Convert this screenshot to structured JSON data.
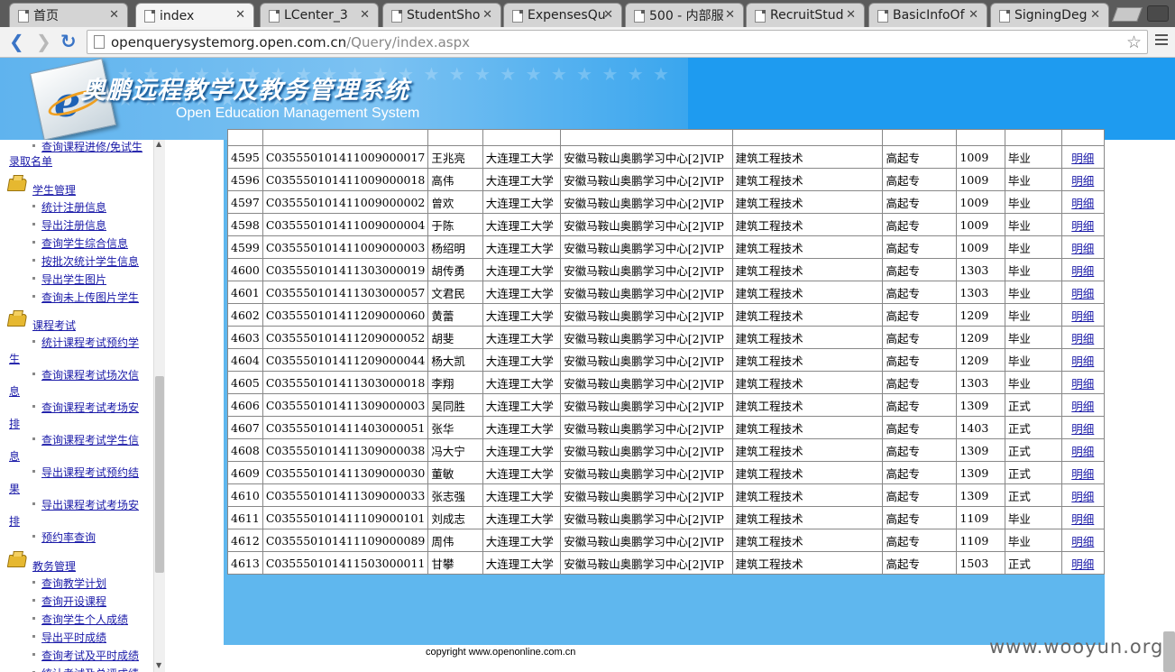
{
  "browser": {
    "tabs": [
      {
        "label": "首页",
        "active": false
      },
      {
        "label": "index",
        "active": true
      },
      {
        "label": "LCenter_3",
        "active": false
      },
      {
        "label": "StudentSho",
        "active": false
      },
      {
        "label": "ExpensesQu",
        "active": false
      },
      {
        "label": "500 - 内部服",
        "active": false
      },
      {
        "label": "RecruitStud",
        "active": false
      },
      {
        "label": "BasicInfoOf",
        "active": false
      },
      {
        "label": "SigningDeg",
        "active": false
      }
    ],
    "url_host": "openquerysystemorg.open.com.cn",
    "url_path": "/Query/index.aspx"
  },
  "header": {
    "title": "奥鹏远程教学及教务管理系统",
    "subtitle": "Open Education Management System"
  },
  "sidebar": {
    "top_links": [
      "查询课程进修/免试生",
      "录取名单"
    ],
    "groups": [
      {
        "title": "学生管理",
        "items": [
          "统计注册信息",
          "导出注册信息",
          "查询学生综合信息",
          "按批次统计学生信息",
          "导出学生图片",
          "查询未上传图片学生"
        ]
      },
      {
        "title": "课程考试",
        "items": [
          {
            "label": "统计课程考试预约学",
            "cont": "生"
          },
          {
            "label": "查询课程考试场次信",
            "cont": "息"
          },
          {
            "label": "查询课程考试考场安",
            "cont": "排"
          },
          {
            "label": "查询课程考试学生信",
            "cont": "息"
          },
          {
            "label": "导出课程考试预约结",
            "cont": "果"
          },
          {
            "label": "导出课程考试考场安",
            "cont": "排"
          },
          {
            "label": "预约率查询",
            "cont": ""
          }
        ]
      },
      {
        "title": "教务管理",
        "items": [
          "查询教学计划",
          "查询开设课程",
          "查询学生个人成绩",
          "导出平时成绩",
          "查询考试及平时成绩",
          "统计考试及总评成绩"
        ]
      }
    ]
  },
  "table": {
    "detail_label": "明细",
    "school": "大连理工大学",
    "center": "安徽马鞍山奥鹏学习中心[2]VIP",
    "major": "建筑工程技术",
    "level": "高起专",
    "rows": [
      {
        "no": "4595",
        "id": "C035550101411009000017",
        "name": "王兆亮",
        "batch": "1009",
        "status": "毕业"
      },
      {
        "no": "4596",
        "id": "C035550101411009000018",
        "name": "高伟",
        "batch": "1009",
        "status": "毕业"
      },
      {
        "no": "4597",
        "id": "C035550101411009000002",
        "name": "曾欢",
        "batch": "1009",
        "status": "毕业"
      },
      {
        "no": "4598",
        "id": "C035550101411009000004",
        "name": "于陈",
        "batch": "1009",
        "status": "毕业"
      },
      {
        "no": "4599",
        "id": "C035550101411009000003",
        "name": "杨绍明",
        "batch": "1009",
        "status": "毕业"
      },
      {
        "no": "4600",
        "id": "C035550101411303000019",
        "name": "胡传勇",
        "batch": "1303",
        "status": "毕业"
      },
      {
        "no": "4601",
        "id": "C035550101411303000057",
        "name": "文君民",
        "batch": "1303",
        "status": "毕业"
      },
      {
        "no": "4602",
        "id": "C035550101411209000060",
        "name": "黄蕾",
        "batch": "1209",
        "status": "毕业"
      },
      {
        "no": "4603",
        "id": "C035550101411209000052",
        "name": "胡斐",
        "batch": "1209",
        "status": "毕业"
      },
      {
        "no": "4604",
        "id": "C035550101411209000044",
        "name": "杨大凯",
        "batch": "1209",
        "status": "毕业"
      },
      {
        "no": "4605",
        "id": "C035550101411303000018",
        "name": "李翔",
        "batch": "1303",
        "status": "毕业"
      },
      {
        "no": "4606",
        "id": "C035550101411309000003",
        "name": "吴同胜",
        "batch": "1309",
        "status": "正式"
      },
      {
        "no": "4607",
        "id": "C035550101411403000051",
        "name": "张华",
        "batch": "1403",
        "status": "正式"
      },
      {
        "no": "4608",
        "id": "C035550101411309000038",
        "name": "冯大宁",
        "batch": "1309",
        "status": "正式"
      },
      {
        "no": "4609",
        "id": "C035550101411309000030",
        "name": "董敏",
        "batch": "1309",
        "status": "正式"
      },
      {
        "no": "4610",
        "id": "C035550101411309000033",
        "name": "张志强",
        "batch": "1309",
        "status": "正式"
      },
      {
        "no": "4611",
        "id": "C035550101411109000101",
        "name": "刘成志",
        "batch": "1109",
        "status": "毕业"
      },
      {
        "no": "4612",
        "id": "C035550101411109000089",
        "name": "周伟",
        "batch": "1109",
        "status": "毕业"
      },
      {
        "no": "4613",
        "id": "C035550101411503000011",
        "name": "甘攀",
        "batch": "1503",
        "status": "正式"
      }
    ]
  },
  "footer": {
    "copyright": "copyright www.openonline.com.cn",
    "watermark": "www.wooyun.org"
  },
  "colors": {
    "banner": "#1e9bf0",
    "panel": "#5fb7ee",
    "link": "#1a1aa8"
  }
}
